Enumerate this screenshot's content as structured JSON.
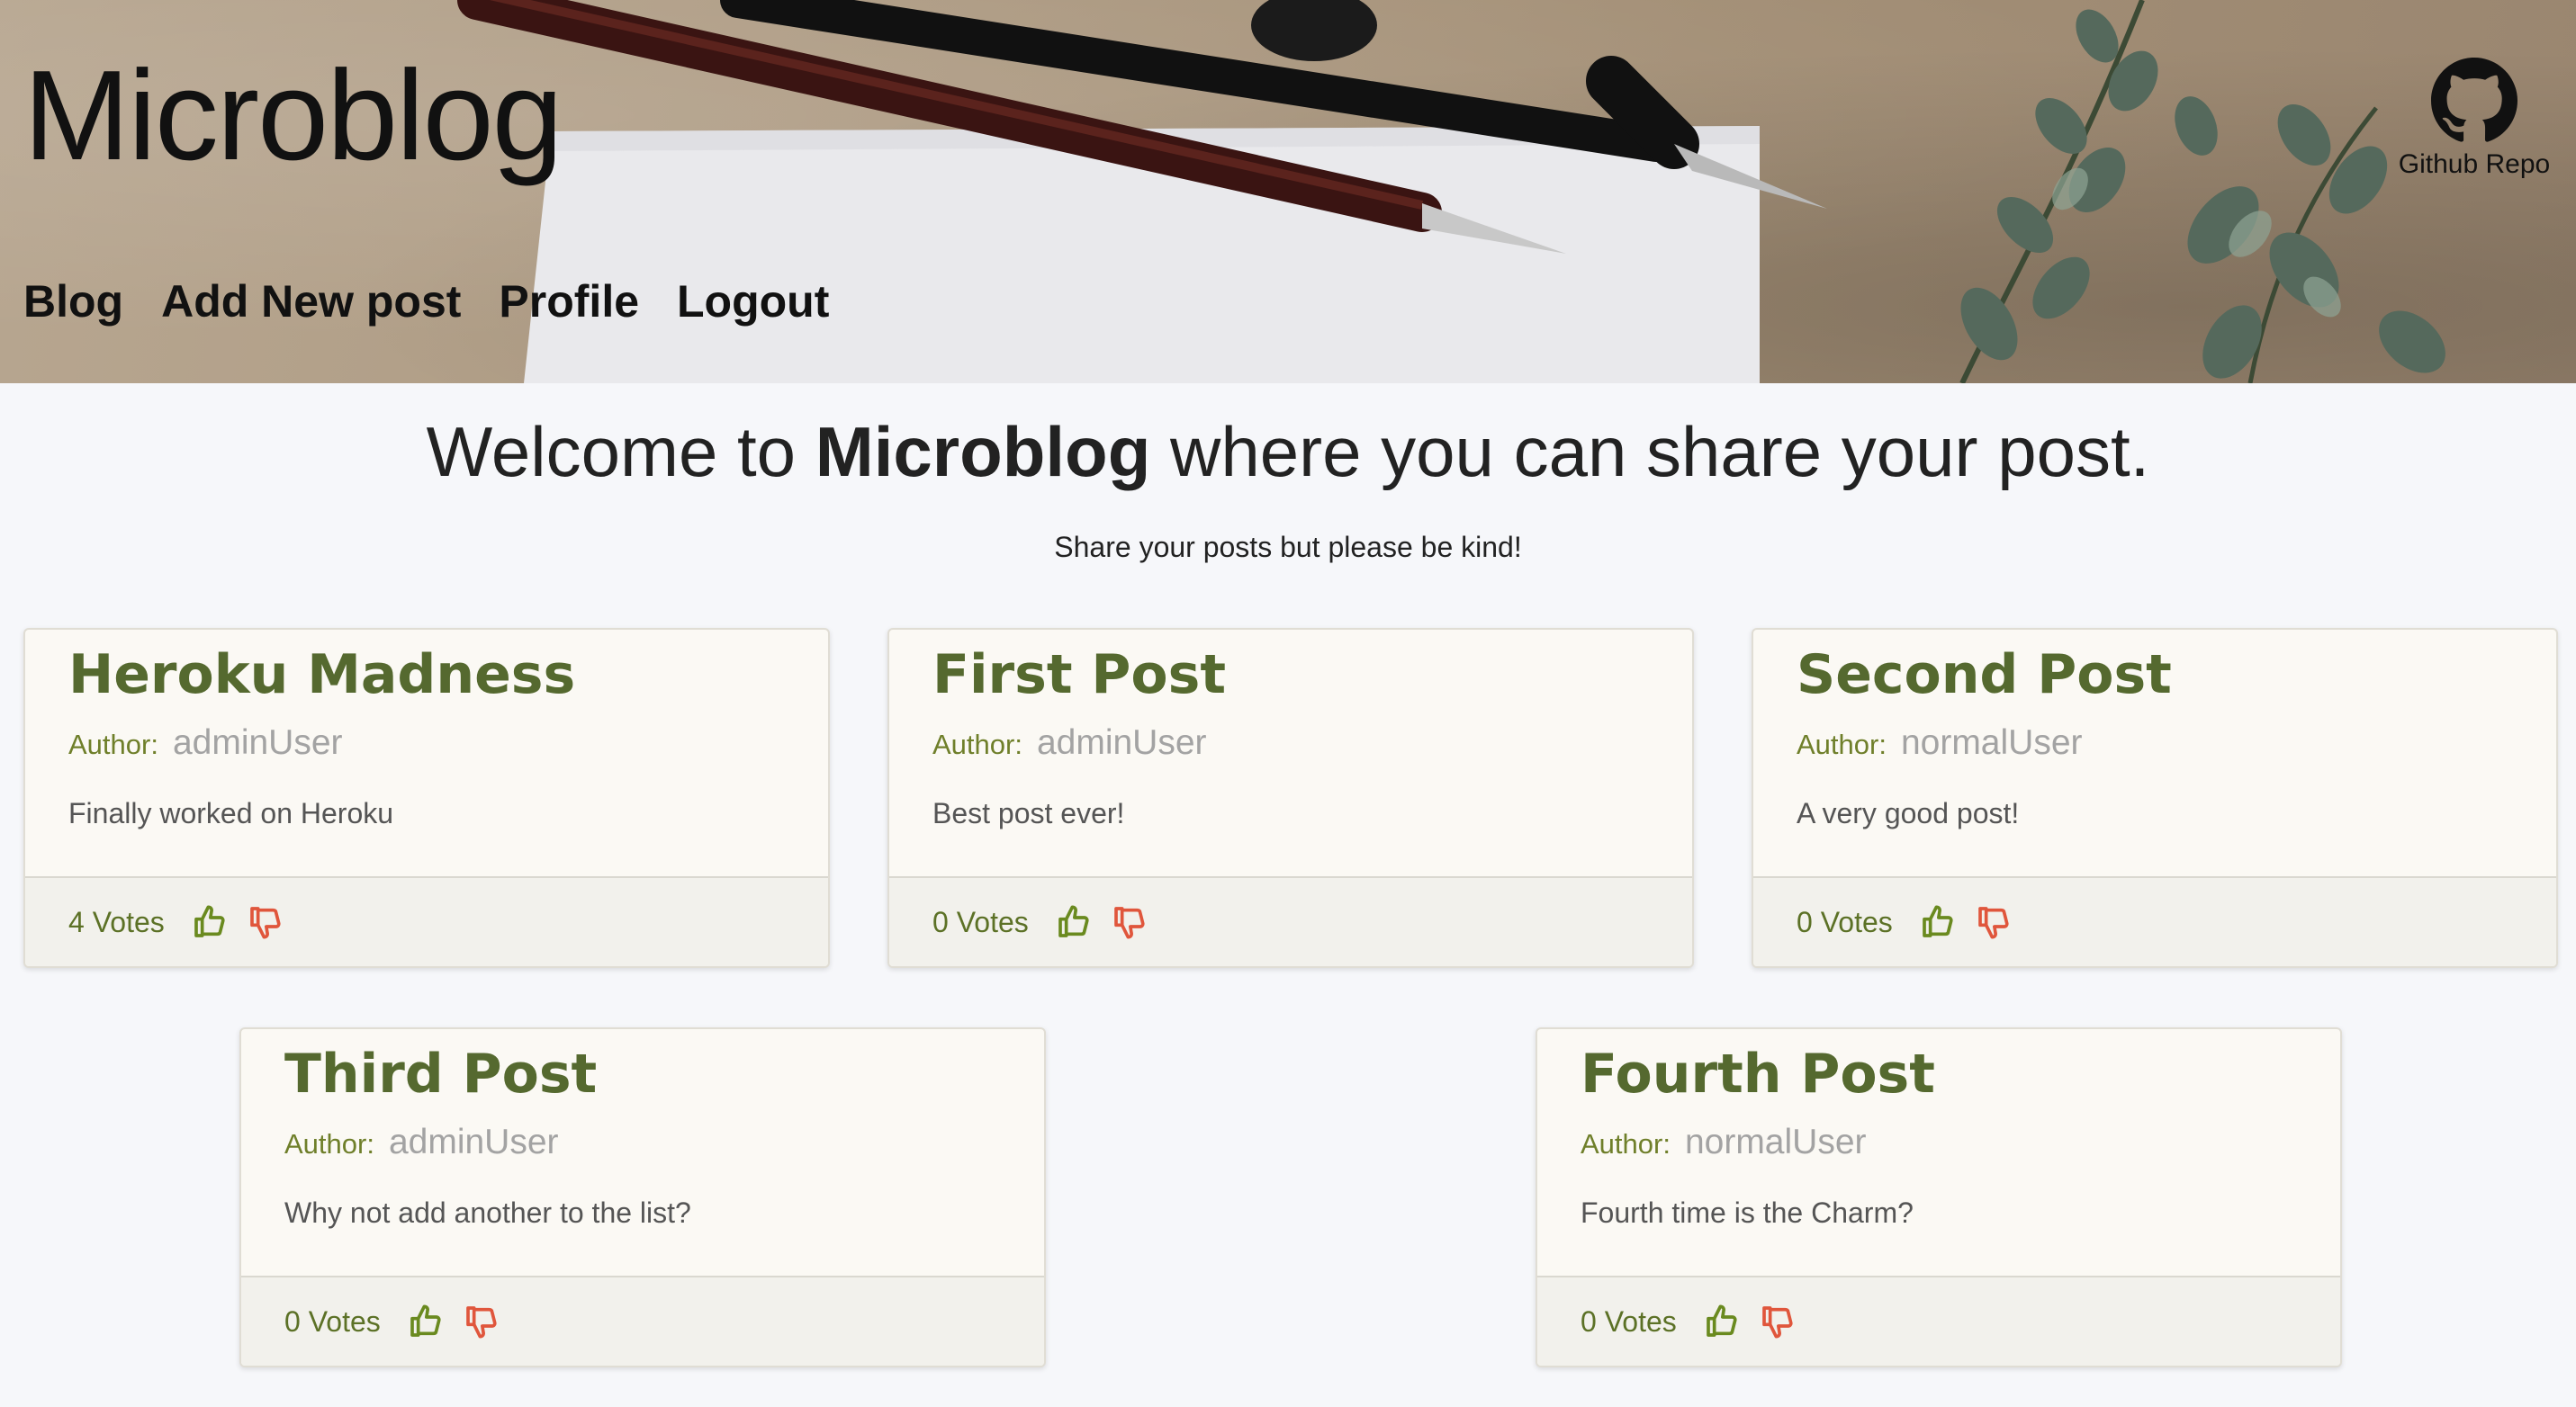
{
  "header": {
    "title": "Microblog",
    "nav": [
      "Blog",
      "Add New post",
      "Profile",
      "Logout"
    ],
    "github_label": "Github Repo"
  },
  "intro": {
    "welcome_prefix": "Welcome to ",
    "welcome_brand": "Microblog",
    "welcome_suffix": " where you can share your post.",
    "tagline": "Share your posts but please be kind!"
  },
  "author_label": "Author:",
  "posts": [
    {
      "title": "Heroku Madness",
      "author": "adminUser",
      "content": "Finally worked on Heroku",
      "votes": "4 Votes"
    },
    {
      "title": "First Post",
      "author": "adminUser",
      "content": "Best post ever!",
      "votes": "0 Votes"
    },
    {
      "title": "Second Post",
      "author": "normalUser",
      "content": "A very good post!",
      "votes": "0 Votes"
    },
    {
      "title": "Third Post",
      "author": "adminUser",
      "content": "Why not add another to the list?",
      "votes": "0 Votes"
    },
    {
      "title": "Fourth Post",
      "author": "normalUser",
      "content": "Fourth time is the Charm?",
      "votes": "0 Votes"
    }
  ],
  "colors": {
    "title_green": "#55692f",
    "upvote": "#6a8a1f",
    "downvote": "#e0563c",
    "page_bg": "#f6f7fa",
    "card_bg": "#fbf9f4"
  },
  "icons": {
    "github": "github-icon",
    "upvote": "thumbs-up-icon",
    "downvote": "thumbs-down-icon"
  }
}
